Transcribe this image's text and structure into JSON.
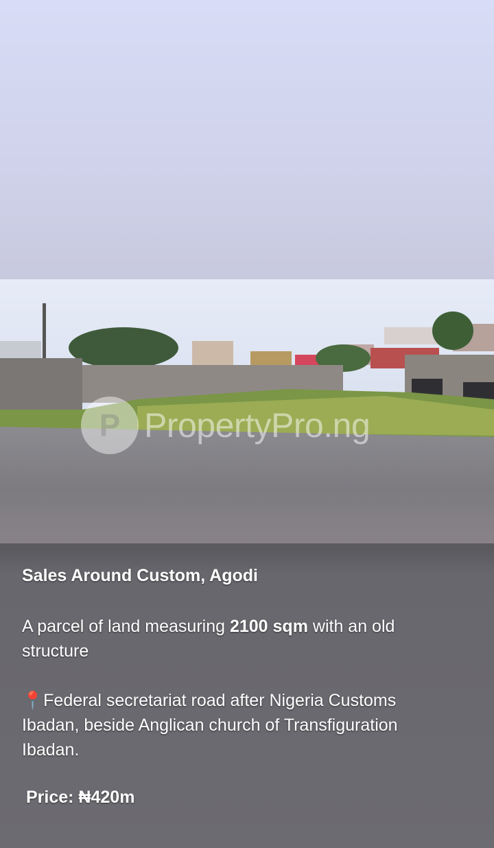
{
  "watermark": {
    "logo_glyph": "P",
    "text": "PropertyPro.ng"
  },
  "post": {
    "title": "Sales Around Custom, Agodi",
    "desc_prefix": " A parcel of land measuring ",
    "desc_size": "2100 sqm",
    "desc_suffix": " with an old structure",
    "location_icon": "📍",
    "location_text": "Federal secretariat road after Nigeria Customs Ibadan, beside Anglican church of Transfiguration Ibadan.",
    "price": "Price: ₦420m"
  },
  "colors": {
    "caption_bg": "#6b6a70",
    "pin": "#e53935"
  }
}
